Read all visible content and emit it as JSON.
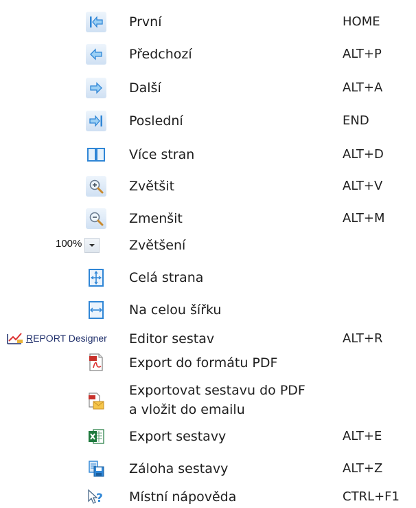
{
  "items": [
    {
      "label": "První",
      "shortcut": "HOME",
      "icon": "first-page-icon"
    },
    {
      "label": "Předchozí",
      "shortcut": "ALT+P",
      "icon": "previous-page-icon"
    },
    {
      "label": "Další",
      "shortcut": "ALT+A",
      "icon": "next-page-icon"
    },
    {
      "label": "Poslední",
      "shortcut": "END",
      "icon": "last-page-icon"
    },
    {
      "label": "Více stran",
      "shortcut": "ALT+D",
      "icon": "multiple-pages-icon"
    },
    {
      "label": "Zvětšit",
      "shortcut": "ALT+V",
      "icon": "zoom-in-icon"
    },
    {
      "label": "Zmenšit",
      "shortcut": "ALT+M",
      "icon": "zoom-out-icon"
    },
    {
      "label": "Zvětšení",
      "shortcut": "",
      "icon": "zoom-dropdown"
    },
    {
      "label": "Celá strana",
      "shortcut": "",
      "icon": "whole-page-icon"
    },
    {
      "label": "Na celou šířku",
      "shortcut": "",
      "icon": "page-width-icon"
    },
    {
      "label": "Editor sestav",
      "shortcut": "ALT+R",
      "icon": "report-designer-icon"
    },
    {
      "label": "Export do formátu PDF",
      "shortcut": "",
      "icon": "pdf-export-icon"
    },
    {
      "label_line1": "Exportovat sestavu do PDF",
      "label_line2": "a vložit do emailu",
      "shortcut": "",
      "icon": "pdf-email-icon"
    },
    {
      "label": "Export sestavy",
      "shortcut": "ALT+E",
      "icon": "excel-export-icon"
    },
    {
      "label": "Záloha sestavy",
      "shortcut": "ALT+Z",
      "icon": "backup-report-icon"
    },
    {
      "label": "Místní nápověda",
      "shortcut": "CTRL+F1",
      "icon": "context-help-icon"
    }
  ],
  "zoom": {
    "value": "100%"
  },
  "report_designer": {
    "prefix": "R",
    "rest": "EPORT Designer"
  },
  "colors": {
    "accent": "#2f86d6",
    "icon_bg": "#cfe0f3"
  }
}
